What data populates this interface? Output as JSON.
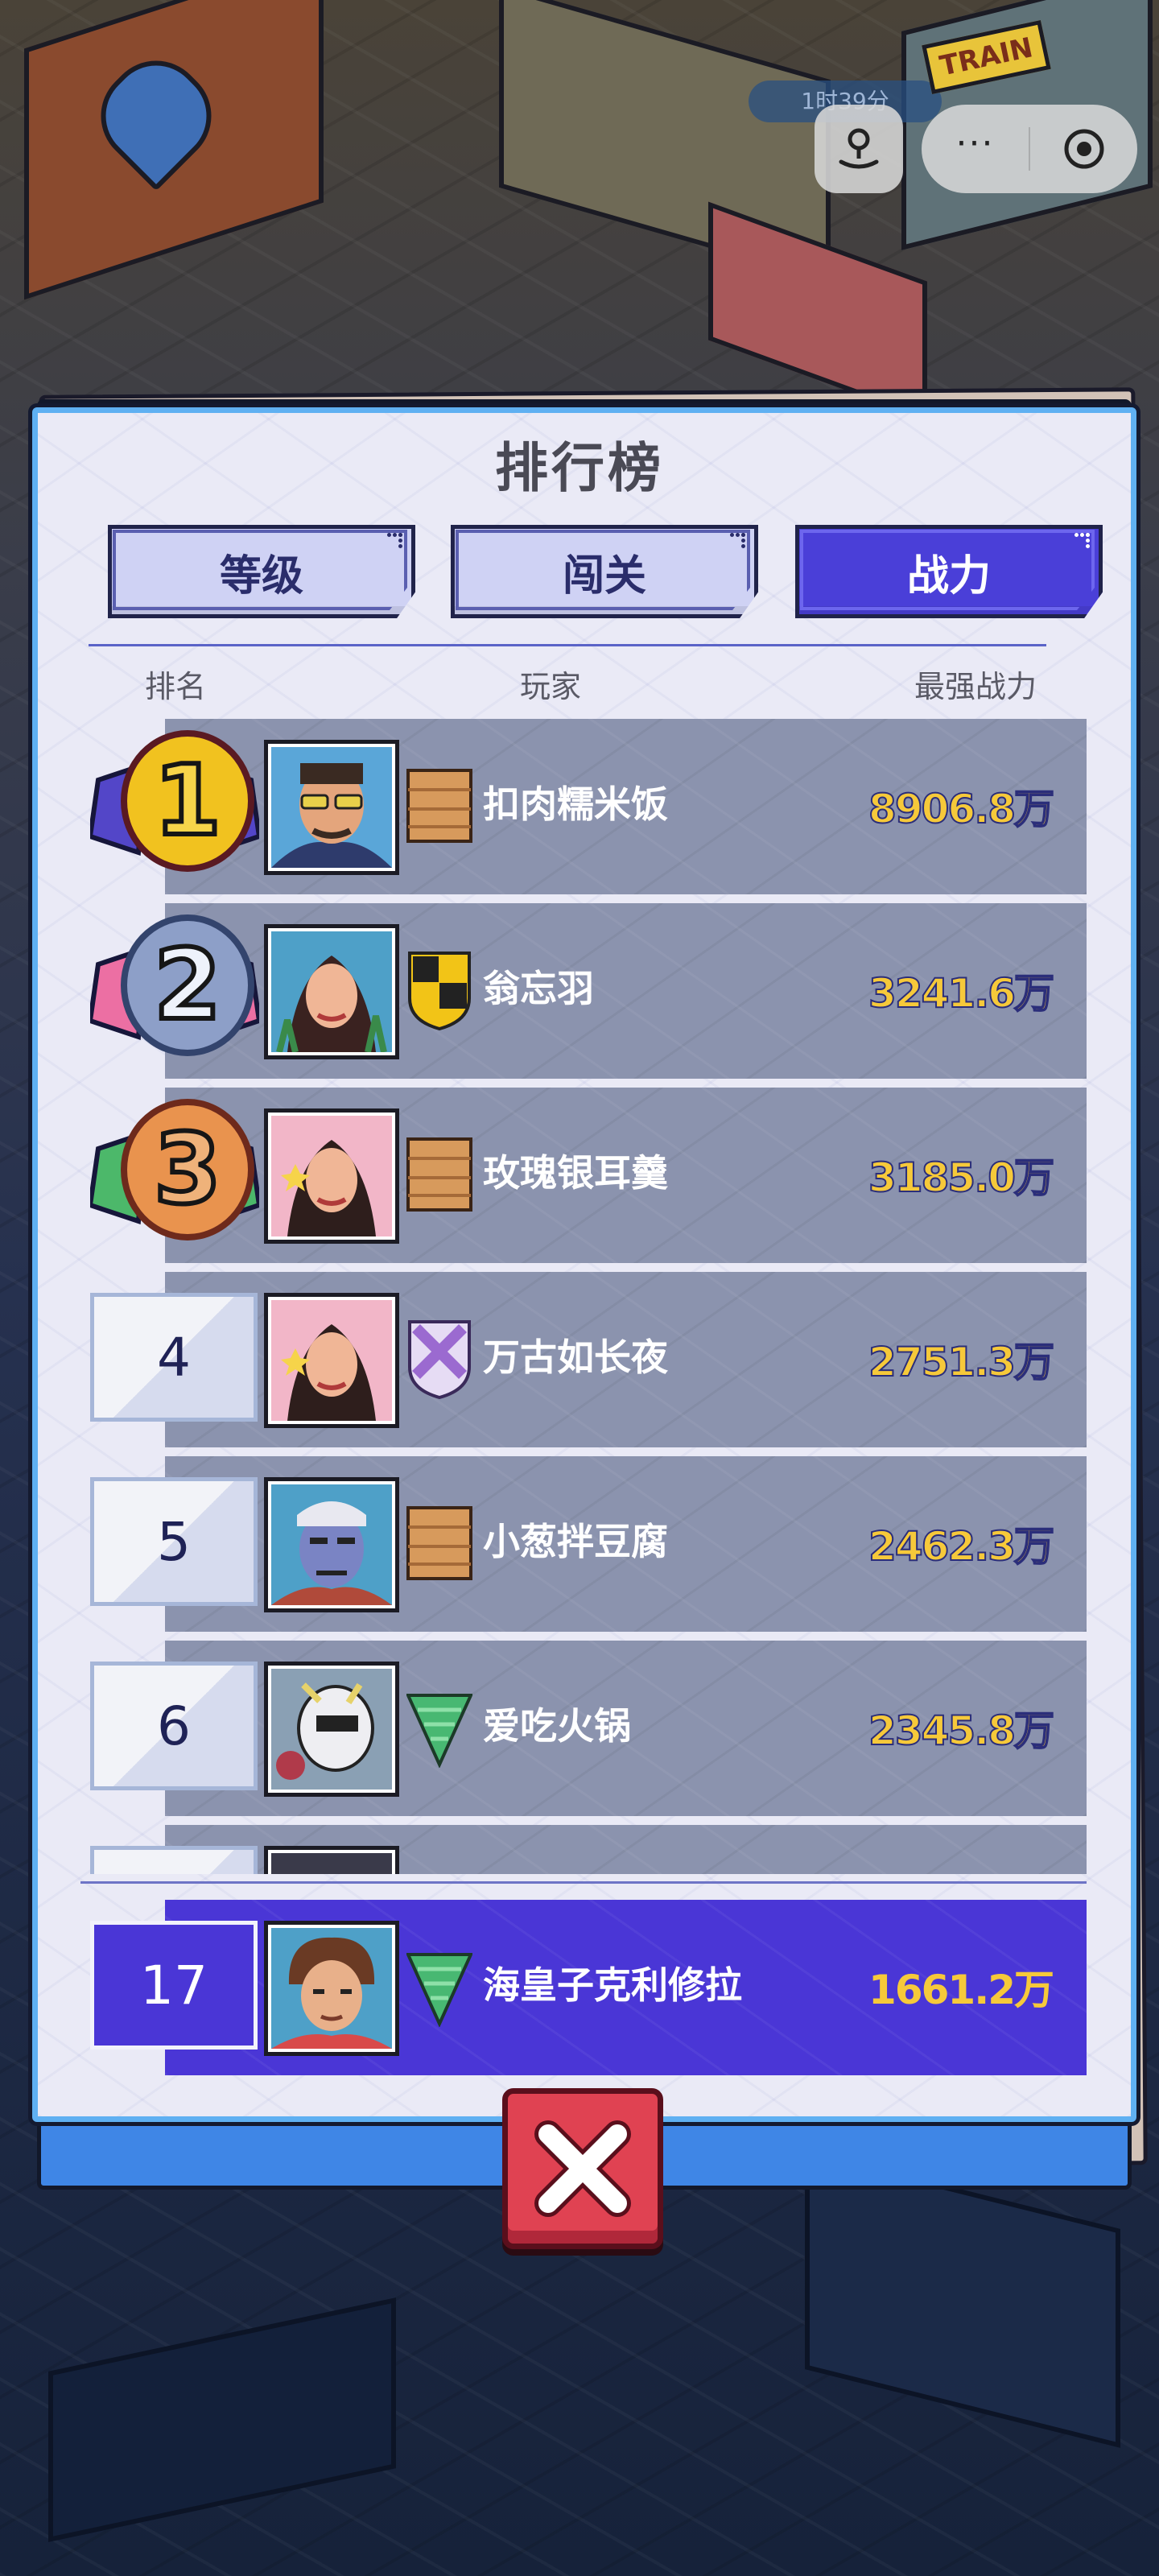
{
  "overlay": {
    "timer_text": "1时39分",
    "sign_text": "TRAIN"
  },
  "capsule": {
    "more_label": "···"
  },
  "leaderboard": {
    "title": "排行榜",
    "tabs": [
      {
        "label": "等级",
        "active": false
      },
      {
        "label": "闯关",
        "active": false
      },
      {
        "label": "战力",
        "active": true
      }
    ],
    "columns": {
      "rank": "排名",
      "player": "玩家",
      "power": "最强战力"
    },
    "rows": [
      {
        "rank": "1",
        "name": "扣肉糯米饭",
        "power": "8906.8万",
        "emblem": "wood-plank-icon",
        "avatar": "sunglasses-man-avatar",
        "medal_color": "#f1c21f"
      },
      {
        "rank": "2",
        "name": "翁忘羽",
        "power": "3241.6万",
        "emblem": "yellow-checker-shield-icon",
        "avatar": "woman-seaweed-avatar",
        "medal_color": "#8d9fc8"
      },
      {
        "rank": "3",
        "name": "玫瑰银耳羹",
        "power": "3185.0万",
        "emblem": "wood-plank-icon",
        "avatar": "woman-star-avatar",
        "medal_color": "#e9934e"
      },
      {
        "rank": "4",
        "name": "万古如长夜",
        "power": "2751.3万",
        "emblem": "purple-cross-shield-icon",
        "avatar": "woman-star-avatar"
      },
      {
        "rank": "5",
        "name": "小葱拌豆腐",
        "power": "2462.3万",
        "emblem": "wood-plank-icon",
        "avatar": "scarred-man-avatar"
      },
      {
        "rank": "6",
        "name": "爱吃火锅",
        "power": "2345.8万",
        "emblem": "green-triangle-icon",
        "avatar": "robot-head-avatar"
      }
    ],
    "my_row": {
      "rank": "17",
      "name": "海皇子克利修拉",
      "power": "1661.2万",
      "emblem": "green-triangle-icon",
      "avatar": "curly-hair-man-avatar"
    }
  },
  "colors": {
    "active_tab": "#4a3fd8",
    "power_text": "#f6c93a",
    "my_row_band": "#4a36d6",
    "close_button": "#e04252"
  }
}
